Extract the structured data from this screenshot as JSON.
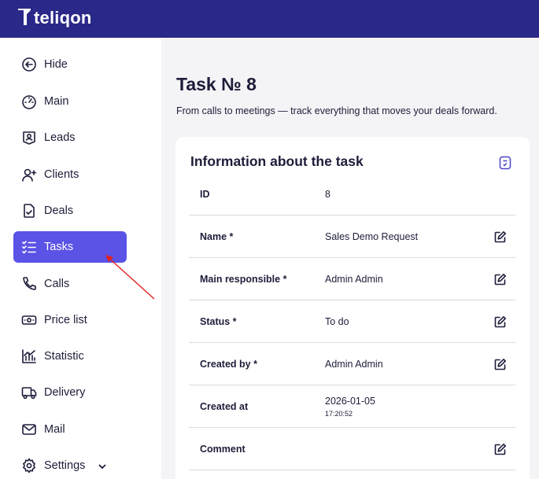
{
  "brand": {
    "name": "teliqon"
  },
  "sidebar": {
    "items": [
      {
        "label": "Hide",
        "icon": "arrow-left-circle-icon"
      },
      {
        "label": "Main",
        "icon": "gauge-icon"
      },
      {
        "label": "Leads",
        "icon": "lead-badge-icon"
      },
      {
        "label": "Clients",
        "icon": "user-plus-icon"
      },
      {
        "label": "Deals",
        "icon": "deal-document-icon"
      },
      {
        "label": "Tasks",
        "icon": "checklist-icon",
        "active": true
      },
      {
        "label": "Calls",
        "icon": "phone-icon"
      },
      {
        "label": "Price list",
        "icon": "banknote-icon"
      },
      {
        "label": "Statistic",
        "icon": "bar-chart-icon"
      },
      {
        "label": "Delivery",
        "icon": "truck-icon"
      },
      {
        "label": "Mail",
        "icon": "mail-icon"
      },
      {
        "label": "Settings",
        "icon": "gear-icon",
        "expandable": true
      }
    ]
  },
  "page": {
    "title": "Task № 8",
    "subtitle": "From calls to meetings — track everything that moves your deals forward."
  },
  "card": {
    "title": "Information about the task",
    "rows": [
      {
        "key": "ID",
        "value": "8",
        "editable": false
      },
      {
        "key": "Name *",
        "value": "Sales Demo Request",
        "editable": true
      },
      {
        "key": "Main responsible *",
        "value": "Admin Admin",
        "editable": true
      },
      {
        "key": "Status *",
        "value": "To do",
        "editable": true
      },
      {
        "key": "Created by *",
        "value": "Admin Admin",
        "editable": true
      },
      {
        "key": "Created at",
        "value": "2026-01-05",
        "time": "17:20:52",
        "editable": false
      },
      {
        "key": "Comment",
        "value": "",
        "editable": true
      }
    ]
  },
  "colors": {
    "topbar": "#2a2888",
    "active_nav": "#5b52e6",
    "annotation_arrow": "#e02020"
  }
}
